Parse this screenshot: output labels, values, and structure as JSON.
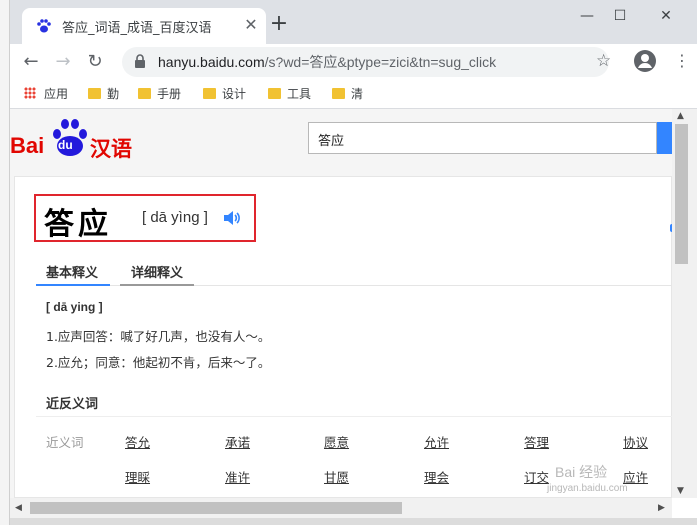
{
  "browser": {
    "tab_title": "答应_词语_成语_百度汉语",
    "tab_close": "✕",
    "new_tab": "+",
    "win_min": "—",
    "win_max": "☐",
    "win_close": "✕",
    "url_host": "hanyu.baidu.com",
    "url_path": "/s?wd=答应&ptype=zici&tn=sug_click",
    "back": "←",
    "forward": "→",
    "reload": "↻",
    "star": "☆",
    "menu": "⋮"
  },
  "bookmarks": [
    {
      "label": "应用",
      "icon": "apps-icon"
    },
    {
      "label": "勤",
      "icon": "folder-icon"
    },
    {
      "label": "手册",
      "icon": "folder-icon"
    },
    {
      "label": "设计",
      "icon": "folder-icon"
    },
    {
      "label": "工具",
      "icon": "folder-icon"
    },
    {
      "label": "清",
      "icon": "folder-icon"
    }
  ],
  "site": {
    "logo_bai": "Bai",
    "logo_du": "du",
    "logo_han": "汉语",
    "search_value": "答应"
  },
  "entry": {
    "word": "答应",
    "pinyin": "[ dā yìng ]",
    "tabs": [
      "基本释义",
      "详细释义"
    ],
    "sub_pinyin": "[ dā ying ]",
    "definitions": [
      "1.应声回答：喊了好几声，也没有人～。",
      "2.应允；同意：他起初不肯，后来～了。"
    ],
    "section_title": "近反义词",
    "synonym_label": "近义词",
    "synonyms_row1": [
      "答允",
      "承诺",
      "愿意",
      "允许",
      "答理",
      "协议"
    ],
    "synonyms_row2": [
      "理睬",
      "准许",
      "甘愿",
      "理会",
      "订交",
      "应许"
    ]
  },
  "watermark": "Bai 经验",
  "watermark_url": "jingyan.baidu.com",
  "colors": {
    "brand_blue": "#2319dc",
    "brand_red": "#e10601",
    "highlight_red": "#e0252d",
    "search_button": "#3385ff",
    "tab_underline_active": "#3385ff"
  }
}
